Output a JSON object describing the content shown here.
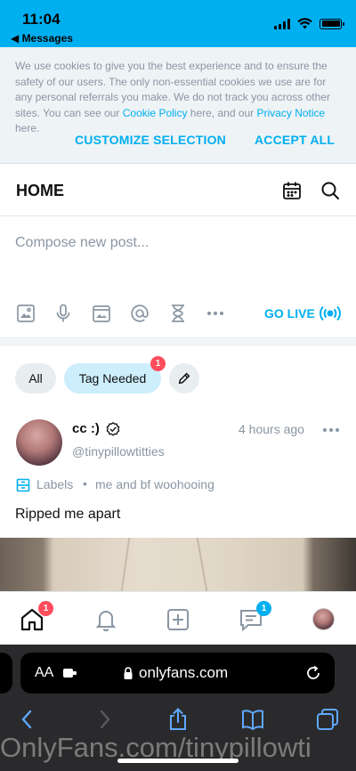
{
  "status_bar": {
    "time": "11:04",
    "back_label": "◀ Messages",
    "icons": [
      "cellular-signal-icon",
      "wifi-icon",
      "battery-icon"
    ]
  },
  "cookie_banner": {
    "text_1": "We use cookies to give you the best experience and to ensure the safety of our users. The only non-essential cookies we use are for any personal referrals you make. We do not track you across other sites. You can see our ",
    "cookie_policy_link": "Cookie Policy",
    "text_2": " here, and our ",
    "privacy_link": "Privacy Notice",
    "text_3": " here.",
    "customize_label": "CUSTOMIZE SELECTION",
    "accept_label": "ACCEPT ALL"
  },
  "header": {
    "title": "HOME",
    "icons": [
      "calendar-icon",
      "search-icon"
    ]
  },
  "compose": {
    "placeholder": "Compose new post...",
    "tools": [
      "image-icon",
      "microphone-icon",
      "vault-icon",
      "mention-icon",
      "hourglass-icon",
      "more-horizontal-icon"
    ],
    "go_live_label": "GO LIVE"
  },
  "filters": {
    "all_label": "All",
    "tag_needed_label": "Tag Needed",
    "tag_needed_badge": "1"
  },
  "post": {
    "name": "cc :)",
    "handle": "@tinypillowtitties",
    "time": "4 hours ago",
    "labels_title": "Labels",
    "labels_separator": "•",
    "label_value": "me and bf woohooing",
    "text": "Ripped me apart"
  },
  "bottom_nav": {
    "items": [
      "home-icon",
      "notifications-icon",
      "add-post-icon",
      "messages-icon",
      "profile-avatar"
    ],
    "home_badge": "1",
    "messages_badge": "1"
  },
  "safari": {
    "aa_label": "AA",
    "url": "onlyfans.com",
    "watermark": "OnlyFans.com/tinypillowti"
  },
  "colors": {
    "accent": "#00aff0",
    "muted": "#8a96a3",
    "badge": "#ff4d5b"
  }
}
